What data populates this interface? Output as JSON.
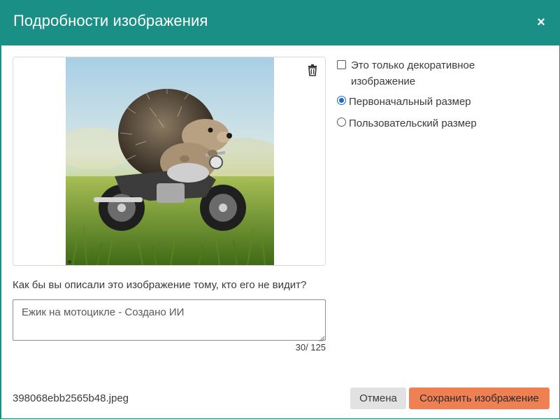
{
  "dialog": {
    "title": "Подробности изображения",
    "close_label": "×"
  },
  "image": {
    "alt": "Ежик на мотоцикле - Создано ИИ",
    "icon_delete": "trash-icon"
  },
  "options": {
    "decorative_label": "Это только декоративное изображение",
    "decorative_checked": false,
    "original_size_label": "Первоначальный размер",
    "custom_size_label": "Пользовательский размер",
    "selected_size": "original"
  },
  "alt_text": {
    "question": "Как бы вы описали это изображение тому, кто его не видит?",
    "value": "Ежик на мотоцикле - Создано ИИ",
    "counter": "30/ 125"
  },
  "footer": {
    "filename": "398068ebb2565b48.jpeg",
    "cancel_label": "Отмена",
    "save_label": "Сохранить изображение"
  },
  "colors": {
    "header_bg": "#1a8f86",
    "save_button": "#ef8053",
    "cancel_button": "#e2e2e2",
    "radio_selected": "#1967d2"
  }
}
